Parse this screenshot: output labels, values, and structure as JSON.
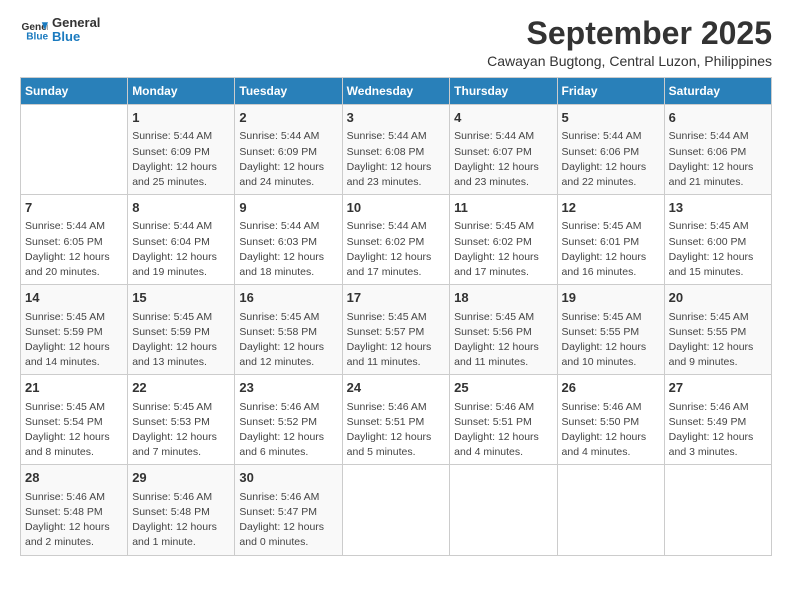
{
  "logo": {
    "line1": "General",
    "line2": "Blue"
  },
  "title": "September 2025",
  "subtitle": "Cawayan Bugtong, Central Luzon, Philippines",
  "days_of_week": [
    "Sunday",
    "Monday",
    "Tuesday",
    "Wednesday",
    "Thursday",
    "Friday",
    "Saturday"
  ],
  "weeks": [
    [
      {
        "day": "",
        "info": ""
      },
      {
        "day": "1",
        "info": "Sunrise: 5:44 AM\nSunset: 6:09 PM\nDaylight: 12 hours\nand 25 minutes."
      },
      {
        "day": "2",
        "info": "Sunrise: 5:44 AM\nSunset: 6:09 PM\nDaylight: 12 hours\nand 24 minutes."
      },
      {
        "day": "3",
        "info": "Sunrise: 5:44 AM\nSunset: 6:08 PM\nDaylight: 12 hours\nand 23 minutes."
      },
      {
        "day": "4",
        "info": "Sunrise: 5:44 AM\nSunset: 6:07 PM\nDaylight: 12 hours\nand 23 minutes."
      },
      {
        "day": "5",
        "info": "Sunrise: 5:44 AM\nSunset: 6:06 PM\nDaylight: 12 hours\nand 22 minutes."
      },
      {
        "day": "6",
        "info": "Sunrise: 5:44 AM\nSunset: 6:06 PM\nDaylight: 12 hours\nand 21 minutes."
      }
    ],
    [
      {
        "day": "7",
        "info": "Sunrise: 5:44 AM\nSunset: 6:05 PM\nDaylight: 12 hours\nand 20 minutes."
      },
      {
        "day": "8",
        "info": "Sunrise: 5:44 AM\nSunset: 6:04 PM\nDaylight: 12 hours\nand 19 minutes."
      },
      {
        "day": "9",
        "info": "Sunrise: 5:44 AM\nSunset: 6:03 PM\nDaylight: 12 hours\nand 18 minutes."
      },
      {
        "day": "10",
        "info": "Sunrise: 5:44 AM\nSunset: 6:02 PM\nDaylight: 12 hours\nand 17 minutes."
      },
      {
        "day": "11",
        "info": "Sunrise: 5:45 AM\nSunset: 6:02 PM\nDaylight: 12 hours\nand 17 minutes."
      },
      {
        "day": "12",
        "info": "Sunrise: 5:45 AM\nSunset: 6:01 PM\nDaylight: 12 hours\nand 16 minutes."
      },
      {
        "day": "13",
        "info": "Sunrise: 5:45 AM\nSunset: 6:00 PM\nDaylight: 12 hours\nand 15 minutes."
      }
    ],
    [
      {
        "day": "14",
        "info": "Sunrise: 5:45 AM\nSunset: 5:59 PM\nDaylight: 12 hours\nand 14 minutes."
      },
      {
        "day": "15",
        "info": "Sunrise: 5:45 AM\nSunset: 5:59 PM\nDaylight: 12 hours\nand 13 minutes."
      },
      {
        "day": "16",
        "info": "Sunrise: 5:45 AM\nSunset: 5:58 PM\nDaylight: 12 hours\nand 12 minutes."
      },
      {
        "day": "17",
        "info": "Sunrise: 5:45 AM\nSunset: 5:57 PM\nDaylight: 12 hours\nand 11 minutes."
      },
      {
        "day": "18",
        "info": "Sunrise: 5:45 AM\nSunset: 5:56 PM\nDaylight: 12 hours\nand 11 minutes."
      },
      {
        "day": "19",
        "info": "Sunrise: 5:45 AM\nSunset: 5:55 PM\nDaylight: 12 hours\nand 10 minutes."
      },
      {
        "day": "20",
        "info": "Sunrise: 5:45 AM\nSunset: 5:55 PM\nDaylight: 12 hours\nand 9 minutes."
      }
    ],
    [
      {
        "day": "21",
        "info": "Sunrise: 5:45 AM\nSunset: 5:54 PM\nDaylight: 12 hours\nand 8 minutes."
      },
      {
        "day": "22",
        "info": "Sunrise: 5:45 AM\nSunset: 5:53 PM\nDaylight: 12 hours\nand 7 minutes."
      },
      {
        "day": "23",
        "info": "Sunrise: 5:46 AM\nSunset: 5:52 PM\nDaylight: 12 hours\nand 6 minutes."
      },
      {
        "day": "24",
        "info": "Sunrise: 5:46 AM\nSunset: 5:51 PM\nDaylight: 12 hours\nand 5 minutes."
      },
      {
        "day": "25",
        "info": "Sunrise: 5:46 AM\nSunset: 5:51 PM\nDaylight: 12 hours\nand 4 minutes."
      },
      {
        "day": "26",
        "info": "Sunrise: 5:46 AM\nSunset: 5:50 PM\nDaylight: 12 hours\nand 4 minutes."
      },
      {
        "day": "27",
        "info": "Sunrise: 5:46 AM\nSunset: 5:49 PM\nDaylight: 12 hours\nand 3 minutes."
      }
    ],
    [
      {
        "day": "28",
        "info": "Sunrise: 5:46 AM\nSunset: 5:48 PM\nDaylight: 12 hours\nand 2 minutes."
      },
      {
        "day": "29",
        "info": "Sunrise: 5:46 AM\nSunset: 5:48 PM\nDaylight: 12 hours\nand 1 minute."
      },
      {
        "day": "30",
        "info": "Sunrise: 5:46 AM\nSunset: 5:47 PM\nDaylight: 12 hours\nand 0 minutes."
      },
      {
        "day": "",
        "info": ""
      },
      {
        "day": "",
        "info": ""
      },
      {
        "day": "",
        "info": ""
      },
      {
        "day": "",
        "info": ""
      }
    ]
  ]
}
